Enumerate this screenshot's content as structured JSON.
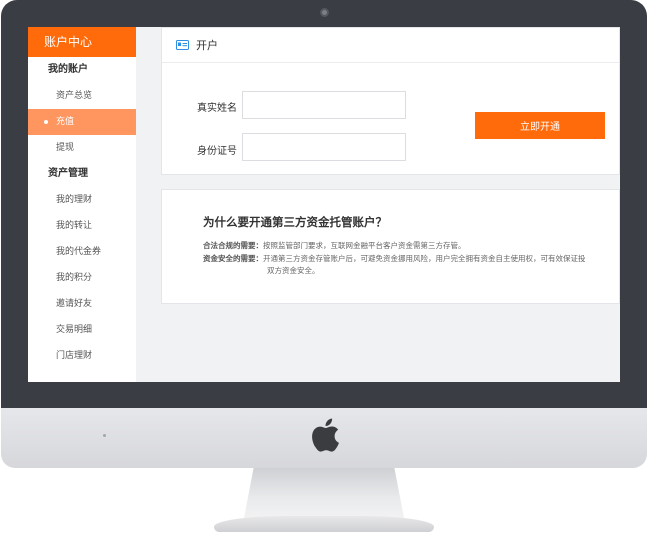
{
  "sidebar": {
    "header": "账户中心",
    "sections": [
      {
        "title": "我的账户",
        "items": [
          "资产总览",
          "充值",
          "提现"
        ]
      },
      {
        "title": "资产管理",
        "items": [
          "我的理财",
          "我的转让",
          "我的代金券",
          "我的积分",
          "邀请好友",
          "交易明细",
          "门店理财"
        ]
      }
    ],
    "active_item": "充值"
  },
  "account_card": {
    "title": "开户",
    "name_label": "真实姓名",
    "name_value": "",
    "id_label": "身份证号",
    "id_value": "",
    "submit_label": "立即开通"
  },
  "info_card": {
    "title": "为什么要开通第三方资金托管账户？",
    "reason1_label": "合法合规的需要：",
    "reason1_text": "按照监管部门要求，互联网金融平台客户资金需第三方存管。",
    "reason2_label": "资金安全的需要：",
    "reason2_text": "开通第三方资金存管账户后，可避免资金挪用风险，用户完全拥有资金自主使用权，可有效保证投",
    "reason2_cont": "双方资金安全。"
  },
  "colors": {
    "accent": "#ff6a0a",
    "active_bg": "#ff9660",
    "bezel": "#3a3d44"
  }
}
